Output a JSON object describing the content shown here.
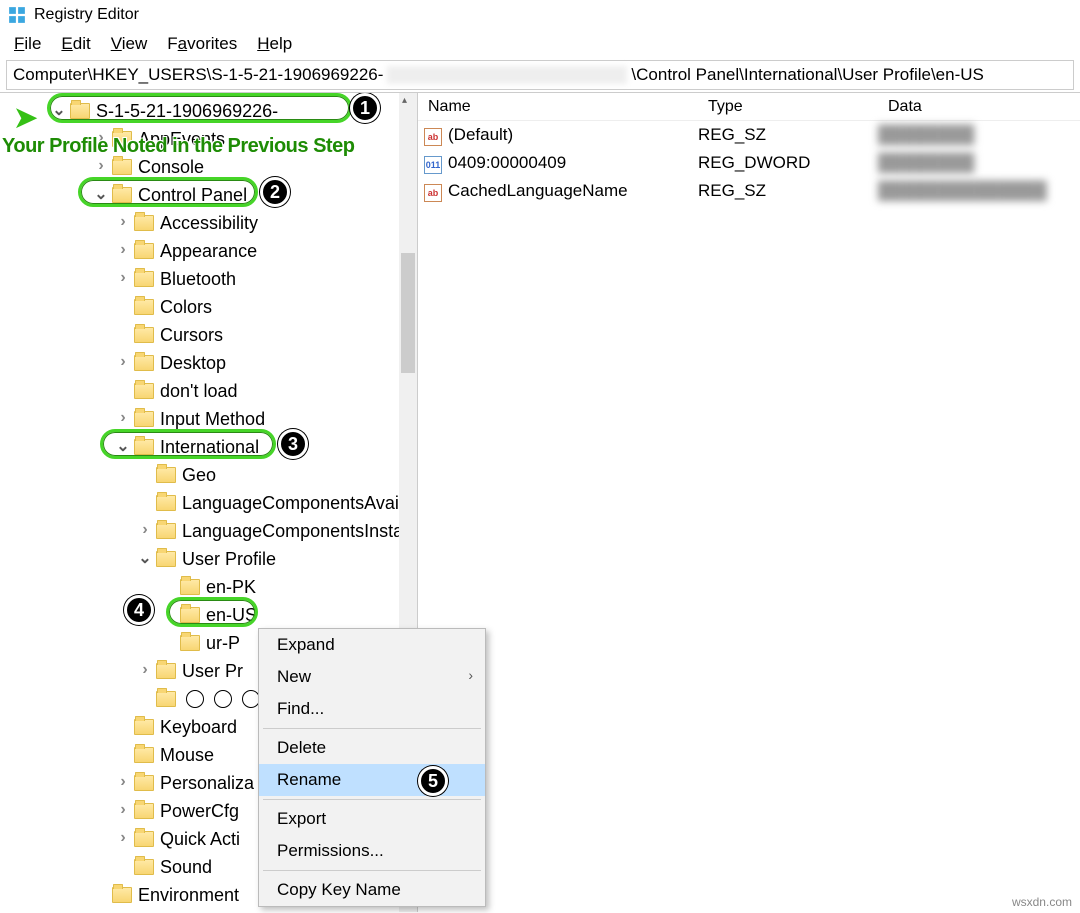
{
  "window": {
    "title": "Registry Editor"
  },
  "menu": {
    "file": "File",
    "edit": "Edit",
    "view": "View",
    "favorites": "Favorites",
    "help": "Help"
  },
  "address": {
    "prefix": "Computer\\HKEY_USERS\\S-1-5-21-1906969226-",
    "suffix": "\\Control Panel\\International\\User Profile\\en-US"
  },
  "tree": {
    "profile_root": "S-1-5-21-1906969226-",
    "items": {
      "appevents": "AppEvents",
      "console": "Console",
      "controlpanel": "Control Panel",
      "accessibility": "Accessibility",
      "appearance": "Appearance",
      "bluetooth": "Bluetooth",
      "colors": "Colors",
      "cursors": "Cursors",
      "desktop": "Desktop",
      "dontload": "don't load",
      "inputmethod": "Input Method",
      "international": "International",
      "geo": "Geo",
      "langavail": "LanguageComponentsAvail",
      "langinst": "LanguageComponentsInsta",
      "userprofile": "User Profile",
      "enpk": "en-PK",
      "enus": "en-US",
      "urp": "ur-P",
      "userpr": "User Pr",
      "globes": "🌐🌐🌐",
      "keyboard": "Keyboard",
      "mouse": "Mouse",
      "personaliz": "Personaliza",
      "powercfg": "PowerCfg",
      "quickact": "Quick Acti",
      "sound": "Sound",
      "environment": "Environment"
    }
  },
  "list": {
    "headers": {
      "name": "Name",
      "type": "Type",
      "data": "Data"
    },
    "rows": [
      {
        "icon": "str",
        "name": "(Default)",
        "type": "REG_SZ"
      },
      {
        "icon": "bin",
        "name": "0409:00000409",
        "type": "REG_DWORD"
      },
      {
        "icon": "str",
        "name": "CachedLanguageName",
        "type": "REG_SZ"
      }
    ]
  },
  "context_menu": {
    "expand": "Expand",
    "new": "New",
    "find": "Find...",
    "delete": "Delete",
    "rename": "Rename",
    "export": "Export",
    "permissions": "Permissions...",
    "copykey": "Copy Key Name"
  },
  "callouts": {
    "profile_note": "Your Profile Noted in the Previous Step",
    "badges": [
      "1",
      "2",
      "3",
      "4",
      "5"
    ]
  },
  "watermark": "wsxdn.com"
}
